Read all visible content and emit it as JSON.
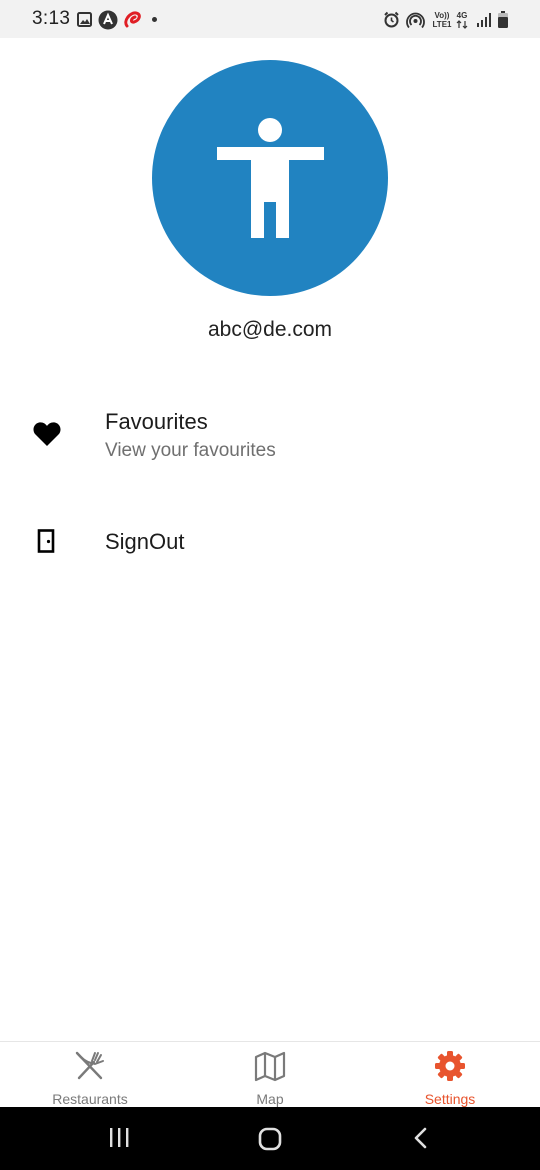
{
  "status_bar": {
    "time": "3:13",
    "volte_top": "Vo))",
    "volte_bottom": "LTE1",
    "network_type": "4G"
  },
  "profile": {
    "email": "abc@de.com",
    "avatar_icon": "accessibility-person-icon",
    "avatar_color": "#2183c1"
  },
  "menu": {
    "items": [
      {
        "title": "Favourites",
        "subtitle": "View your favourites",
        "icon": "heart-icon"
      },
      {
        "title": "SignOut",
        "icon": "door-icon"
      }
    ]
  },
  "tabs": [
    {
      "label": "Restaurants",
      "icon": "fork-knife-icon",
      "active": false
    },
    {
      "label": "Map",
      "icon": "map-icon",
      "active": false
    },
    {
      "label": "Settings",
      "icon": "gear-icon",
      "active": true
    }
  ],
  "colors": {
    "accent": "#e8542e",
    "inactive": "#7a7a7a"
  }
}
